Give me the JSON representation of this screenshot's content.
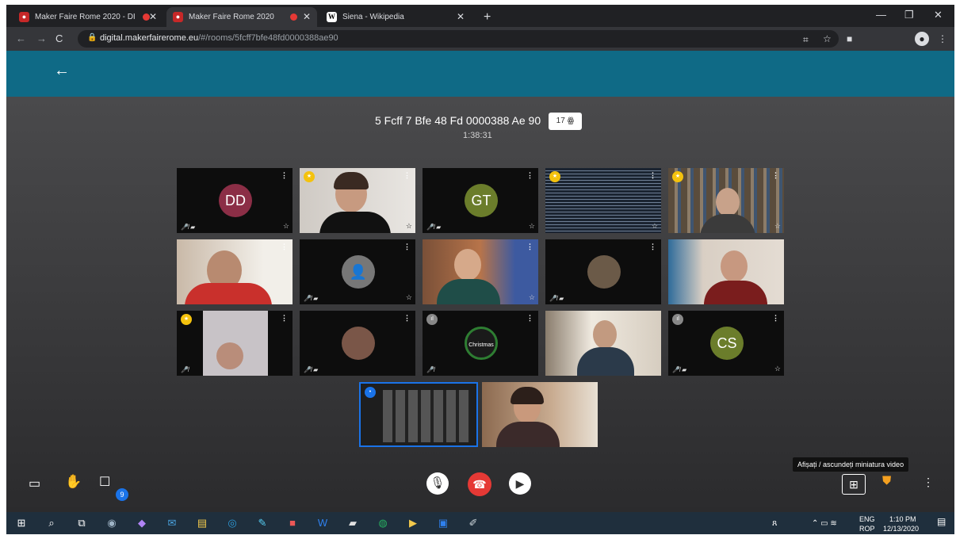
{
  "browser": {
    "tabs": [
      {
        "title": "Maker Faire Rome 2020 - DI"
      },
      {
        "title": "Maker Faire Rome 2020"
      },
      {
        "title": "Siena - Wikipedia"
      }
    ],
    "url_host": "digital.makerfairerome.eu",
    "url_path": "/#/rooms/5fcff7bfe48fd0000388ae90",
    "window_controls": [
      "minimize-icon",
      "maximize-icon",
      "close-icon"
    ]
  },
  "meeting": {
    "room_title": "5 Fcff 7 Bfe 48 Fd 0000388 Ae 90",
    "participant_count": "17",
    "timer": "1:38:31",
    "tiles": [
      {
        "initials": "DD",
        "color": "#8b2e46"
      },
      {
        "initials": ""
      },
      {
        "initials": "GT",
        "color": "#6b7d2b"
      },
      {
        "initials": ""
      },
      {
        "initials": ""
      },
      {
        "initials": ""
      },
      {
        "initials": ""
      },
      {
        "initials": ""
      },
      {
        "initials": ""
      },
      {
        "initials": ""
      },
      {
        "initials": ""
      },
      {
        "initials": ""
      },
      {
        "initials": ""
      },
      {
        "initials": ""
      },
      {
        "initials": "CS",
        "color": "#6b7d2b"
      },
      {
        "initials": ""
      },
      {
        "initials": ""
      }
    ],
    "christmas_text": "Christmas",
    "tooltip": "Afișați / ascundeți miniatura video",
    "chat_count": "9"
  },
  "taskbar": {
    "lang_top": "ENG",
    "lang_bottom": "ROP",
    "time": "1:10 PM",
    "date": "12/13/2020"
  },
  "colors": {
    "header": "#0f6a86",
    "hangup": "#e53935",
    "accent_badge": "#1a73e8"
  }
}
